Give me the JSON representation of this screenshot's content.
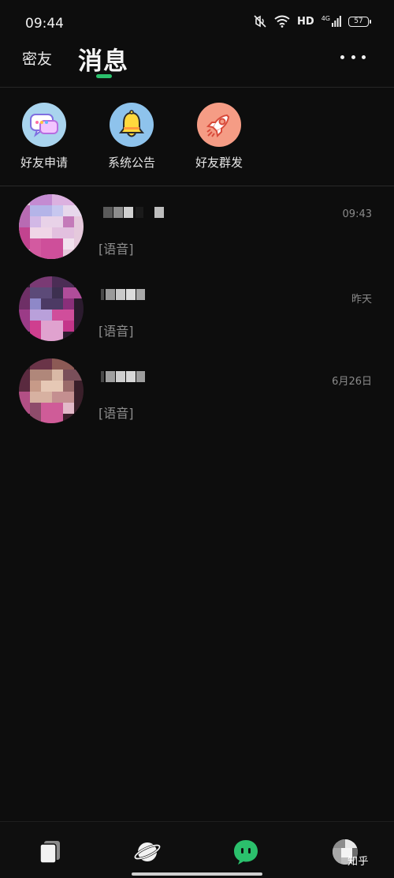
{
  "status_bar": {
    "time": "09:44",
    "hd": "HD",
    "network": "4G",
    "battery": "57"
  },
  "header": {
    "tab_friends": "密友",
    "tab_messages": "消息",
    "accent": "#2bc06c"
  },
  "shortcuts": [
    {
      "label": "好友申请",
      "icon": "chat-bubbles-icon",
      "color": "#a9d4ee"
    },
    {
      "label": "系统公告",
      "icon": "bell-icon",
      "color": "#8ec3ec"
    },
    {
      "label": "好友群发",
      "icon": "rocket-icon",
      "color": "#f59c85"
    }
  ],
  "chats": [
    {
      "preview": "[语音]",
      "time": "09:43"
    },
    {
      "preview": "[语音]",
      "time": "昨天"
    },
    {
      "preview": "[语音]",
      "time": "6月26日"
    }
  ],
  "bottom_nav": [
    {
      "name": "cards-icon"
    },
    {
      "name": "planet-icon"
    },
    {
      "name": "message-icon",
      "color": "#2bc06c"
    },
    {
      "name": "profile-avatar"
    }
  ],
  "watermark": "知乎"
}
